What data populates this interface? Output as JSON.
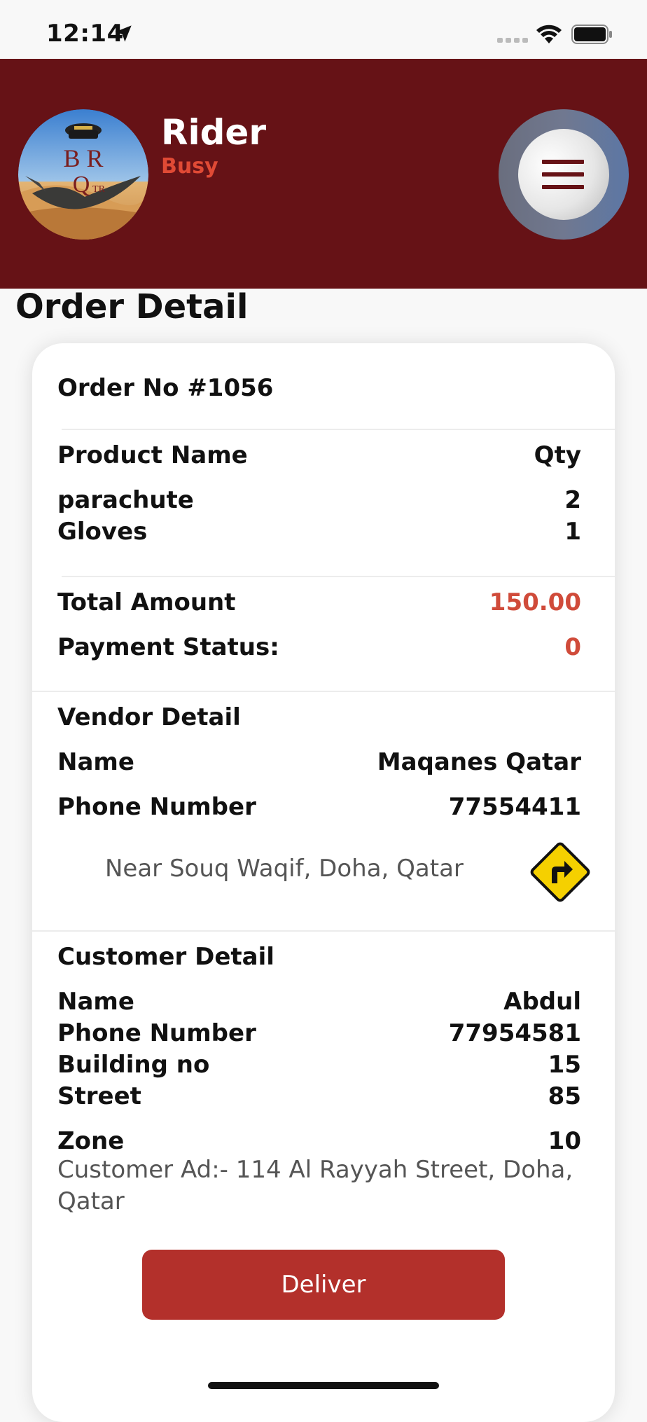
{
  "status_bar": {
    "time": "12:14"
  },
  "header": {
    "rider_name": "Rider",
    "rider_status": "Busy",
    "logo_text": "BRQ TR",
    "bg_color": "#661216",
    "status_color": "#e04a35"
  },
  "page_title": "Order Detail",
  "order": {
    "order_no": "Order No #1056",
    "product_header": "Product Name",
    "qty_header": "Qty",
    "products": [
      {
        "name": "parachute",
        "qty": "2"
      },
      {
        "name": "Gloves",
        "qty": "1"
      }
    ],
    "total_label": "Total Amount",
    "total_value": "150.00",
    "payment_label": "Payment Status:",
    "payment_value": "0"
  },
  "vendor": {
    "title": "Vendor Detail",
    "name_label": "Name",
    "name_value": "Maqanes Qatar",
    "phone_label": "Phone Number",
    "phone_value": "77554411",
    "address": "Near Souq Waqif, Doha, Qatar",
    "directions_icon": "directions-sign-icon"
  },
  "customer": {
    "title": "Customer Detail",
    "name_label": "Name",
    "name_value": "Abdul",
    "phone_label": "Phone Number",
    "phone_value": "77954581",
    "building_label": "Building no",
    "building_value": "15",
    "street_label": "Street",
    "street_value": "85",
    "zone_label": "Zone",
    "zone_value": "10",
    "address": "Customer Ad:- 114 Al Rayyah Street, Doha, Qatar"
  },
  "actions": {
    "deliver_label": "Deliver",
    "accent_color": "#b3302b"
  }
}
